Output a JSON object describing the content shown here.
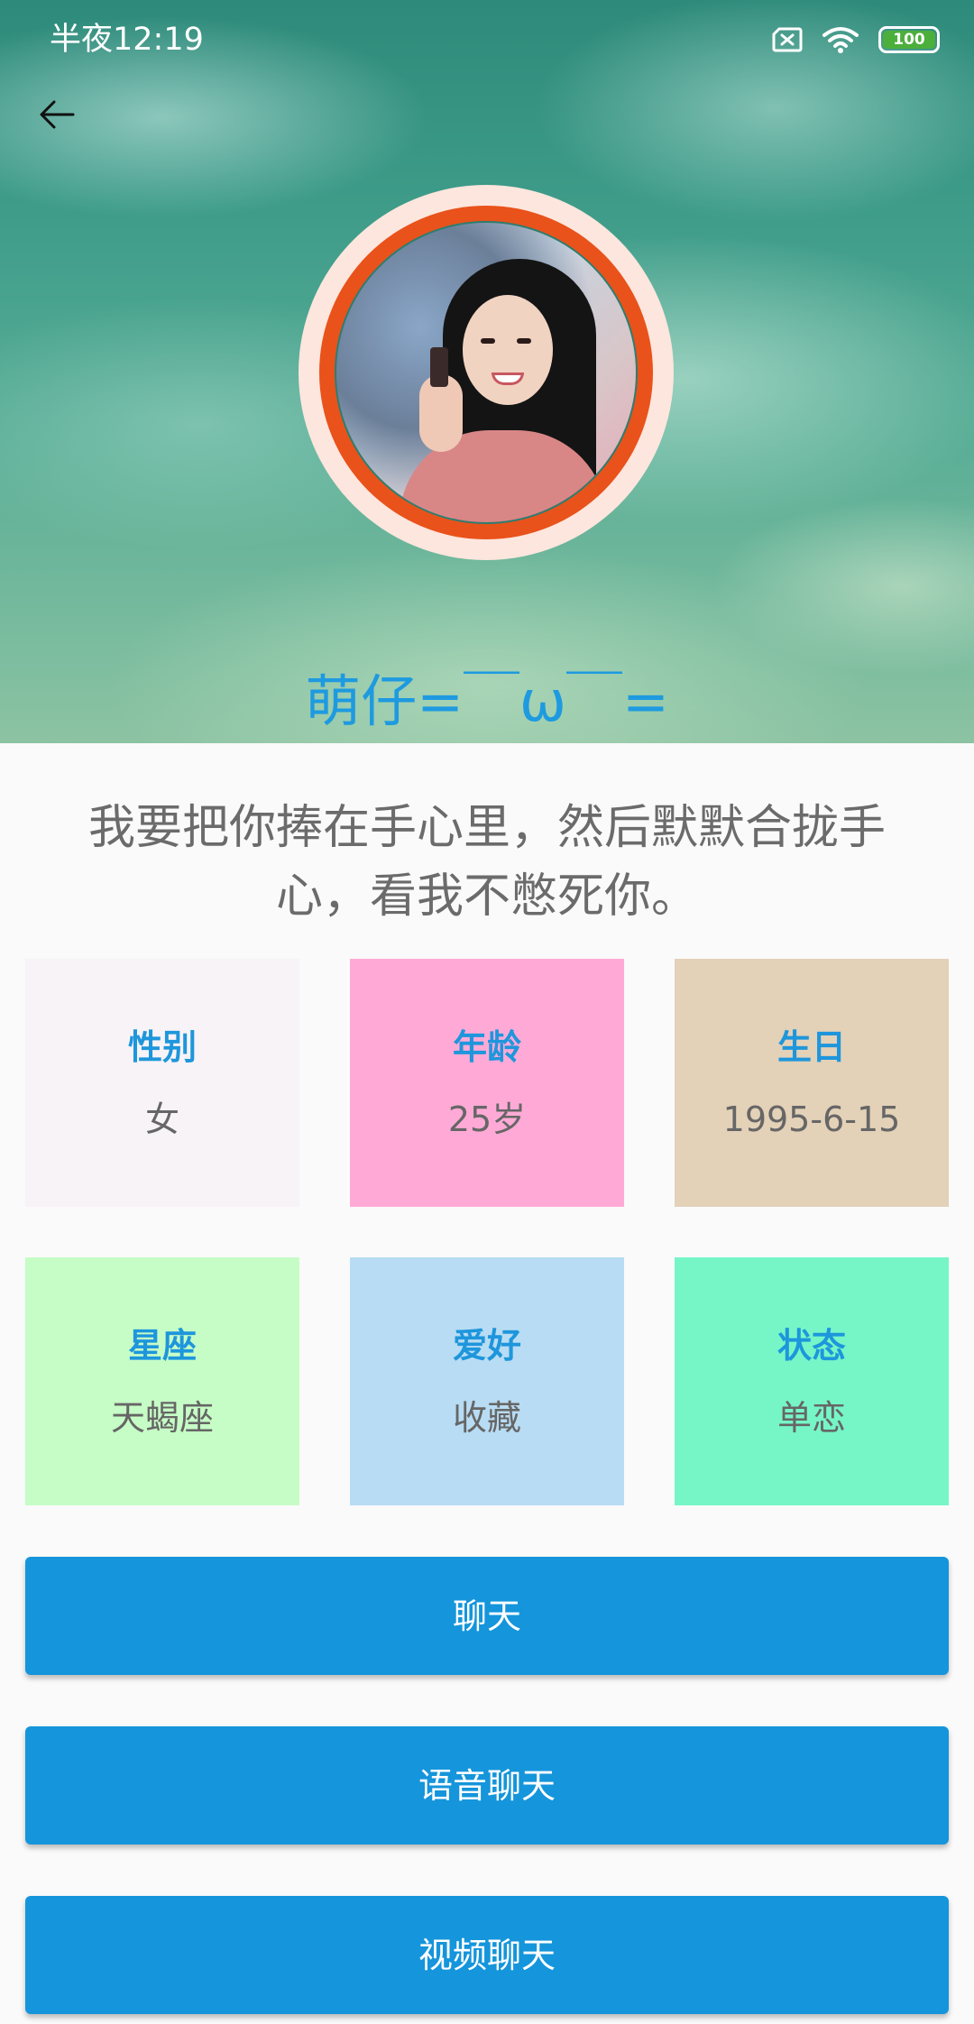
{
  "status_bar": {
    "time": "半夜12:19",
    "battery": "100",
    "icons": [
      "sim-off-icon",
      "wifi-icon",
      "battery-icon"
    ]
  },
  "header": {
    "back_icon": "arrow-left-icon",
    "nickname": "萌仔=￣ω￣=",
    "avatar": "profile-photo"
  },
  "signature": "我要把你捧在手心里，然后默默合拢手心，看我不憋死你。",
  "info_cards": [
    {
      "label": "性别",
      "value": "女",
      "color": "#f8f3f6"
    },
    {
      "label": "年龄",
      "value": "25岁",
      "color": "#ffaad6"
    },
    {
      "label": "生日",
      "value": "1995-6-15",
      "color": "#e3d1b8"
    },
    {
      "label": "星座",
      "value": "天蝎座",
      "color": "#c6fdc6"
    },
    {
      "label": "爱好",
      "value": "收藏",
      "color": "#b8dcf3"
    },
    {
      "label": "状态",
      "value": "单恋",
      "color": "#76f6c7"
    }
  ],
  "buttons": {
    "chat": "聊天",
    "voice_chat": "语音聊天",
    "video_chat": "视频聊天"
  },
  "colors": {
    "accent": "#1595db",
    "label_blue": "#1e96dc",
    "avatar_ring": "#e9521b"
  }
}
